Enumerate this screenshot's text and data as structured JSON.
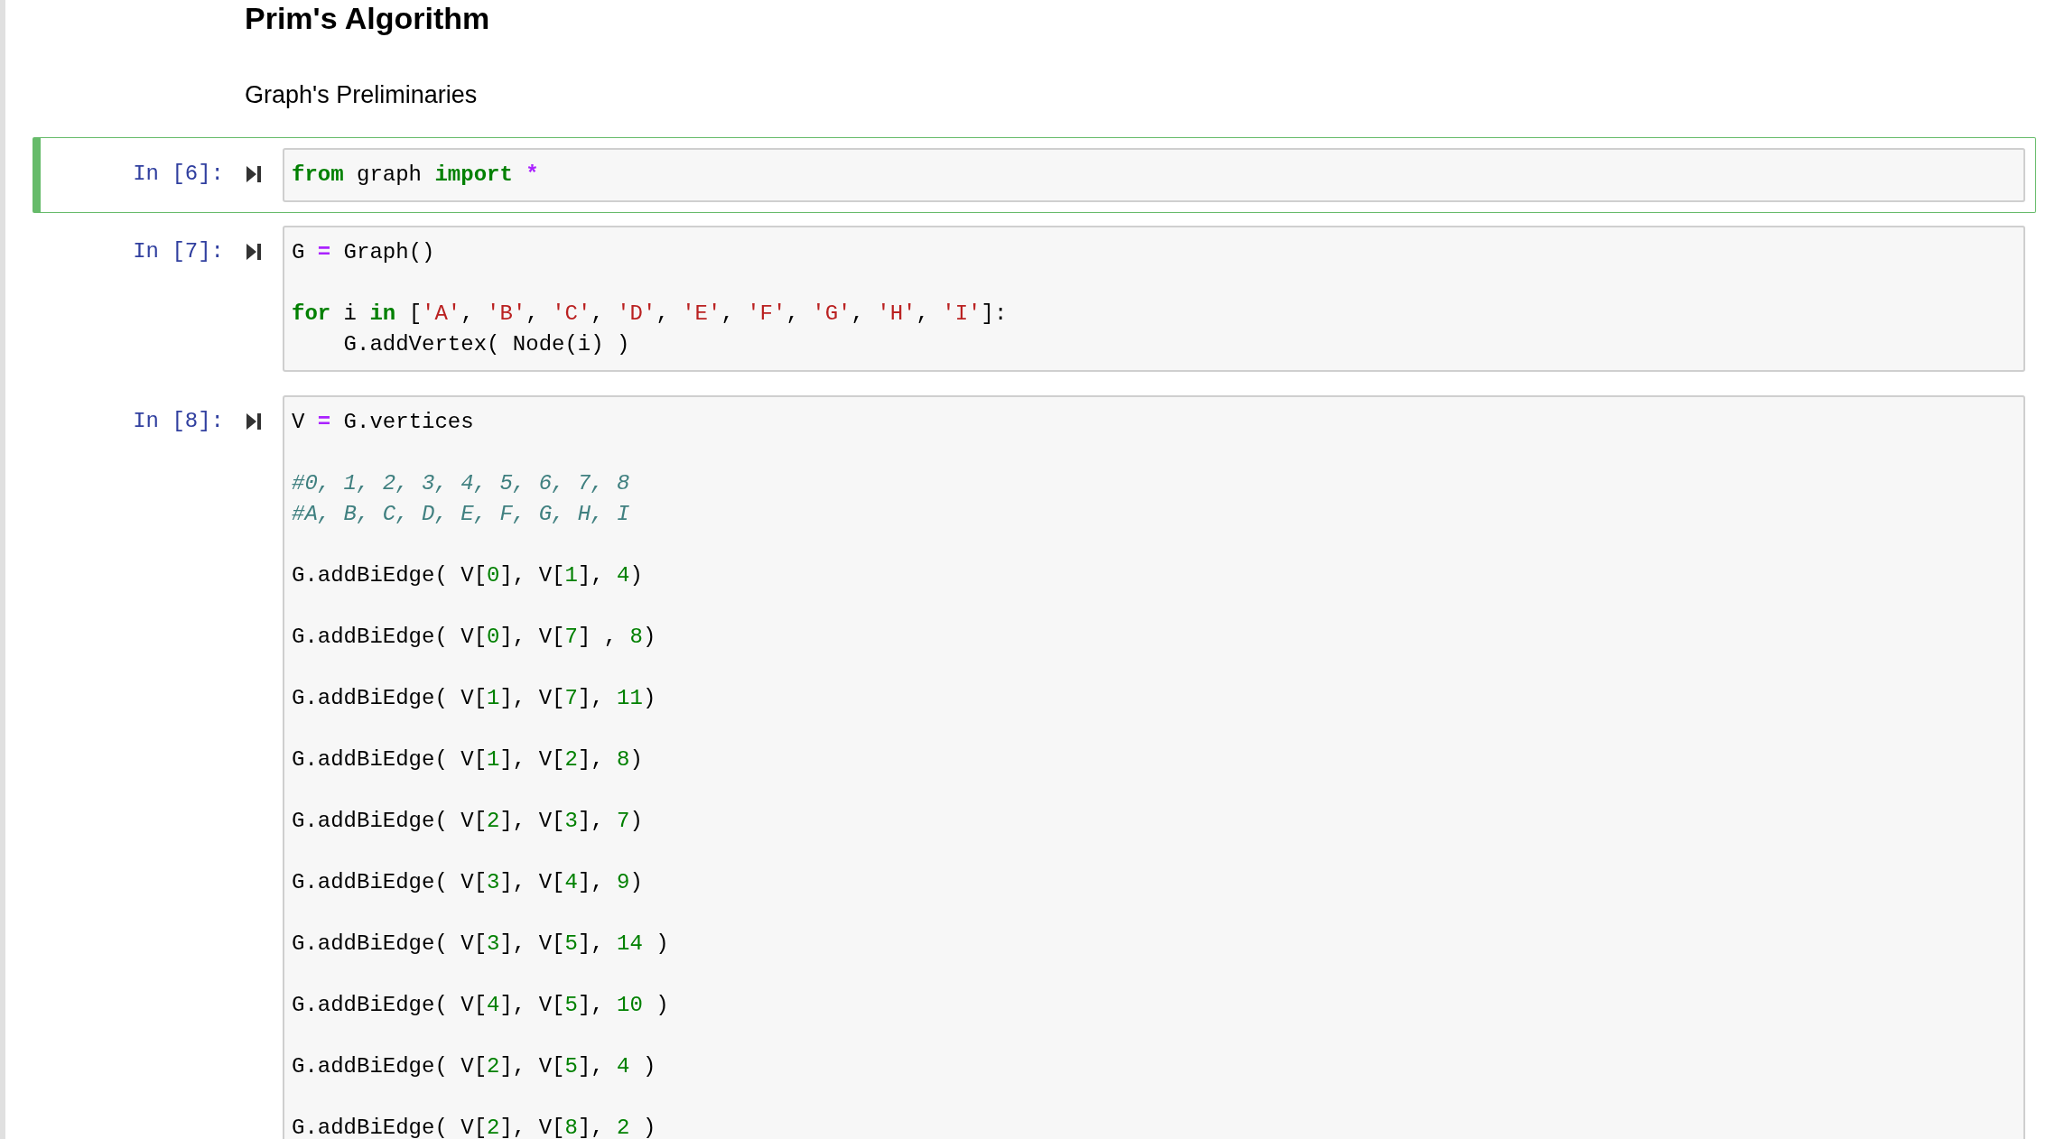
{
  "heading": "Prim's Algorithm",
  "subheading": "Graph's Preliminaries",
  "cells": [
    {
      "prompt": "In [6]:",
      "selected": true,
      "blocks": [
        [
          {
            "tokens": [
              {
                "t": "from",
                "kind": "kw"
              },
              {
                "t": " graph ",
                "kind": "plain"
              },
              {
                "t": "import",
                "kind": "kw"
              },
              {
                "t": " *",
                "kind": "op"
              }
            ]
          }
        ]
      ]
    },
    {
      "prompt": "In [7]:",
      "selected": false,
      "blocks": [
        [
          {
            "tokens": [
              {
                "t": "G ",
                "kind": "plain"
              },
              {
                "t": "=",
                "kind": "op"
              },
              {
                "t": " Graph()",
                "kind": "plain"
              }
            ]
          }
        ],
        [
          {
            "tokens": [
              {
                "t": "for",
                "kind": "kw"
              },
              {
                "t": " i ",
                "kind": "plain"
              },
              {
                "t": "in",
                "kind": "kw"
              },
              {
                "t": " [",
                "kind": "plain"
              },
              {
                "t": "'A'",
                "kind": "str"
              },
              {
                "t": ", ",
                "kind": "plain"
              },
              {
                "t": "'B'",
                "kind": "str"
              },
              {
                "t": ", ",
                "kind": "plain"
              },
              {
                "t": "'C'",
                "kind": "str"
              },
              {
                "t": ", ",
                "kind": "plain"
              },
              {
                "t": "'D'",
                "kind": "str"
              },
              {
                "t": ", ",
                "kind": "plain"
              },
              {
                "t": "'E'",
                "kind": "str"
              },
              {
                "t": ", ",
                "kind": "plain"
              },
              {
                "t": "'F'",
                "kind": "str"
              },
              {
                "t": ", ",
                "kind": "plain"
              },
              {
                "t": "'G'",
                "kind": "str"
              },
              {
                "t": ", ",
                "kind": "plain"
              },
              {
                "t": "'H'",
                "kind": "str"
              },
              {
                "t": ", ",
                "kind": "plain"
              },
              {
                "t": "'I'",
                "kind": "str"
              },
              {
                "t": "]:",
                "kind": "plain"
              }
            ]
          },
          {
            "tokens": [
              {
                "t": "    G.addVertex( Node(i) )",
                "kind": "plain"
              }
            ]
          }
        ]
      ]
    },
    {
      "prompt": "In [8]:",
      "selected": false,
      "blocks": [
        [
          {
            "tokens": [
              {
                "t": "V ",
                "kind": "plain"
              },
              {
                "t": "=",
                "kind": "op"
              },
              {
                "t": " G.vertices",
                "kind": "plain"
              }
            ]
          }
        ],
        [
          {
            "tokens": [
              {
                "t": "#0, 1, 2, 3, 4, 5, 6, 7, 8",
                "kind": "comment"
              }
            ]
          },
          {
            "tokens": [
              {
                "t": "#A, B, C, D, E, F, G, H, I",
                "kind": "comment"
              }
            ]
          }
        ],
        [
          {
            "tokens": [
              {
                "t": "G.addBiEdge( V[",
                "kind": "plain"
              },
              {
                "t": "0",
                "kind": "num"
              },
              {
                "t": "], V[",
                "kind": "plain"
              },
              {
                "t": "1",
                "kind": "num"
              },
              {
                "t": "], ",
                "kind": "plain"
              },
              {
                "t": "4",
                "kind": "num"
              },
              {
                "t": ")",
                "kind": "plain"
              }
            ]
          }
        ],
        [
          {
            "tokens": [
              {
                "t": "G.addBiEdge( V[",
                "kind": "plain"
              },
              {
                "t": "0",
                "kind": "num"
              },
              {
                "t": "], V[",
                "kind": "plain"
              },
              {
                "t": "7",
                "kind": "num"
              },
              {
                "t": "] , ",
                "kind": "plain"
              },
              {
                "t": "8",
                "kind": "num"
              },
              {
                "t": ")",
                "kind": "plain"
              }
            ]
          }
        ],
        [
          {
            "tokens": [
              {
                "t": "G.addBiEdge( V[",
                "kind": "plain"
              },
              {
                "t": "1",
                "kind": "num"
              },
              {
                "t": "], V[",
                "kind": "plain"
              },
              {
                "t": "7",
                "kind": "num"
              },
              {
                "t": "], ",
                "kind": "plain"
              },
              {
                "t": "11",
                "kind": "num"
              },
              {
                "t": ")",
                "kind": "plain"
              }
            ]
          }
        ],
        [
          {
            "tokens": [
              {
                "t": "G.addBiEdge( V[",
                "kind": "plain"
              },
              {
                "t": "1",
                "kind": "num"
              },
              {
                "t": "], V[",
                "kind": "plain"
              },
              {
                "t": "2",
                "kind": "num"
              },
              {
                "t": "], ",
                "kind": "plain"
              },
              {
                "t": "8",
                "kind": "num"
              },
              {
                "t": ")",
                "kind": "plain"
              }
            ]
          }
        ],
        [
          {
            "tokens": [
              {
                "t": "G.addBiEdge( V[",
                "kind": "plain"
              },
              {
                "t": "2",
                "kind": "num"
              },
              {
                "t": "], V[",
                "kind": "plain"
              },
              {
                "t": "3",
                "kind": "num"
              },
              {
                "t": "], ",
                "kind": "plain"
              },
              {
                "t": "7",
                "kind": "num"
              },
              {
                "t": ")",
                "kind": "plain"
              }
            ]
          }
        ],
        [
          {
            "tokens": [
              {
                "t": "G.addBiEdge( V[",
                "kind": "plain"
              },
              {
                "t": "3",
                "kind": "num"
              },
              {
                "t": "], V[",
                "kind": "plain"
              },
              {
                "t": "4",
                "kind": "num"
              },
              {
                "t": "], ",
                "kind": "plain"
              },
              {
                "t": "9",
                "kind": "num"
              },
              {
                "t": ")",
                "kind": "plain"
              }
            ]
          }
        ],
        [
          {
            "tokens": [
              {
                "t": "G.addBiEdge( V[",
                "kind": "plain"
              },
              {
                "t": "3",
                "kind": "num"
              },
              {
                "t": "], V[",
                "kind": "plain"
              },
              {
                "t": "5",
                "kind": "num"
              },
              {
                "t": "], ",
                "kind": "plain"
              },
              {
                "t": "14",
                "kind": "num"
              },
              {
                "t": " )",
                "kind": "plain"
              }
            ]
          }
        ],
        [
          {
            "tokens": [
              {
                "t": "G.addBiEdge( V[",
                "kind": "plain"
              },
              {
                "t": "4",
                "kind": "num"
              },
              {
                "t": "], V[",
                "kind": "plain"
              },
              {
                "t": "5",
                "kind": "num"
              },
              {
                "t": "], ",
                "kind": "plain"
              },
              {
                "t": "10",
                "kind": "num"
              },
              {
                "t": " )",
                "kind": "plain"
              }
            ]
          }
        ],
        [
          {
            "tokens": [
              {
                "t": "G.addBiEdge( V[",
                "kind": "plain"
              },
              {
                "t": "2",
                "kind": "num"
              },
              {
                "t": "], V[",
                "kind": "plain"
              },
              {
                "t": "5",
                "kind": "num"
              },
              {
                "t": "], ",
                "kind": "plain"
              },
              {
                "t": "4",
                "kind": "num"
              },
              {
                "t": " )",
                "kind": "plain"
              }
            ]
          }
        ],
        [
          {
            "tokens": [
              {
                "t": "G.addBiEdge( V[",
                "kind": "plain"
              },
              {
                "t": "2",
                "kind": "num"
              },
              {
                "t": "], V[",
                "kind": "plain"
              },
              {
                "t": "8",
                "kind": "num"
              },
              {
                "t": "], ",
                "kind": "plain"
              },
              {
                "t": "2",
                "kind": "num"
              },
              {
                "t": " )",
                "kind": "plain"
              }
            ]
          }
        ]
      ]
    }
  ]
}
